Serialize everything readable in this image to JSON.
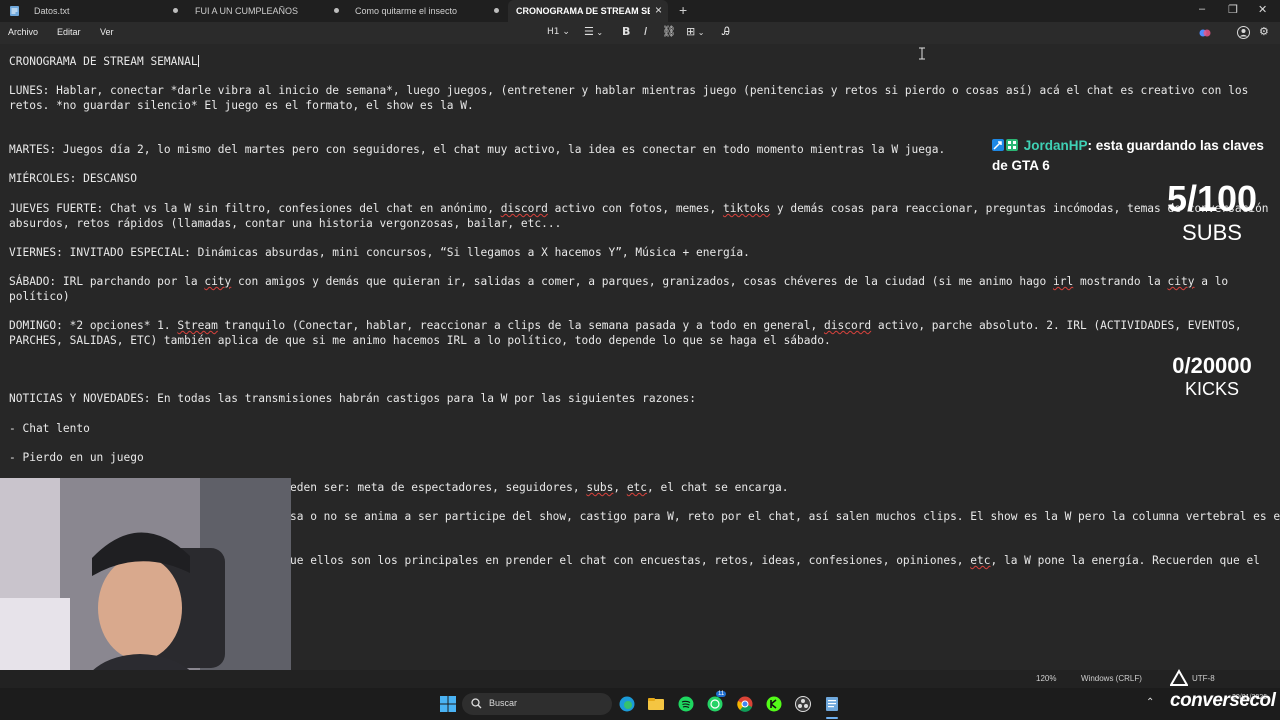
{
  "tabs": [
    {
      "title": "Datos.txt",
      "active": false
    },
    {
      "title": "FUI A UN CUMPLEAÑOS",
      "active": false
    },
    {
      "title": "Como quitarme el insecto",
      "active": false
    },
    {
      "title": "CRONOGRAMA DE STREAM SEMAN",
      "active": true
    }
  ],
  "menu": {
    "file": "Archivo",
    "edit": "Editar",
    "view": "Ver"
  },
  "toolbar": {
    "heading": "H1"
  },
  "document": {
    "title": "CRONOGRAMA DE STREAM SEMANAL",
    "l_lunes_1": "LUNES: Hablar, conectar *darle vibra al inicio de semana*, luego juegos, (entretener y hablar mientras juego (penitencias y retos si pierdo o cosas así) acá el chat es creativo con los",
    "l_lunes_2": "retos. *no guardar silencio* El juego es el formato, el show es la W.",
    "l_martes": "MARTES: Juegos día 2, lo mismo del martes pero con seguidores, el chat muy activo, la idea es conectar en todo momento mientras la W juega.",
    "l_miercoles": "MIÉRCOLES: DESCANSO",
    "j1_a": "JUEVES FUERTE: Chat vs la W sin filtro, confesiones del chat en anónimo, ",
    "j1_discord": "discord",
    "j1_b": " activo con fotos, memes, ",
    "j1_tiktoks": "tiktoks",
    "j1_c": " y demás cosas para reaccionar, preguntas incómodas, temas de conversación",
    "l_jueves_2": "absurdos, retos rápidos (llamadas, contar una historia vergonzosas, bailar, etc...",
    "l_viernes": "VIERNES: INVITADO ESPECIAL: Dinámicas absurdas, mini concursos, “Si llegamos a X hacemos Y”, Música + energía.",
    "s1_a": "SÁBADO: IRL parchando por la ",
    "s1_city": "city",
    "s1_b": " con amigos y demás que quieran ir, salidas a comer, a parques, granizados, cosas chéveres de la ciudad (si me animo hago ",
    "s1_irl": "irl",
    "s1_c": " mostrando la ",
    "s1_city2": "city",
    "s1_d": " a lo",
    "l_sabado_2": "político)",
    "d1_a": "DOMINGO: *2 opciones* 1. ",
    "d1_stream": "Stream",
    "d1_b": " tranquilo (Conectar, hablar, reaccionar a clips de la semana pasada y a todo en general, ",
    "d1_discord": "discord",
    "d1_c": " activo, parche absoluto. 2. IRL (ACTIVIDADES, EVENTOS,",
    "l_domingo_2": "PARCHES, SALIDAS, ETC) también aplica de que si me animo hacemos IRL a lo político, todo depende lo que se haga el sábado.",
    "l_noticias": "NOTICIAS Y NOVEDADES: En todas las transmisiones habrán castigos para la W por las siguientes razones:",
    "l_chat_lento": "- Chat lento",
    "l_pierdo": "- Pierdo en un juego",
    "p1_a": "eden ser: meta de espectadores, seguidores, ",
    "p1_subs": "subs",
    "p1_b": ", ",
    "p1_etc": "etc",
    "p1_c": ", el chat se encarga.",
    "l_partial_2": "sa o no se anima a ser participe del show, castigo para W, reto por el chat, así salen muchos clips. El show es la W pero la columna vertebral es el",
    "p3_a": "ue ellos son los principales en prender el chat con encuestas, retos, ideas, confesiones, opiniones, ",
    "p3_etc": "etc",
    "p3_b": ", la W pone la energía. Recuerden que el"
  },
  "overlay": {
    "chat_user": "JordanHP",
    "chat_message": ": esta guardando las claves de GTA 6",
    "subs_count": "5/100",
    "subs_label": "SUBS",
    "kicks_count": "0/20000",
    "kicks_label": "KICKS",
    "brand": "conversecol"
  },
  "status": {
    "zoom": "120%",
    "line_ending": "Windows (CRLF)",
    "encoding": "UTF-8"
  },
  "taskbar": {
    "search_label": "Buscar",
    "whatsapp_badge": "11",
    "date": "20/01/2026"
  }
}
